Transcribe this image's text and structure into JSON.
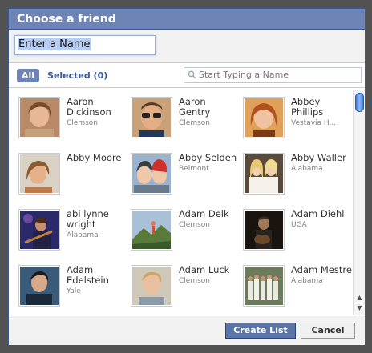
{
  "dialog": {
    "title": "Choose a friend"
  },
  "name_input": {
    "value": "Enter a Name"
  },
  "filter": {
    "all_label": "All",
    "selected_label": "Selected (0)",
    "search_placeholder": "Start Typing a Name"
  },
  "friends": [
    {
      "name": "Aaron Dickinson",
      "network": "Clemson"
    },
    {
      "name": "Aaron Gentry",
      "network": "Clemson"
    },
    {
      "name": "Abbey Phillips",
      "network": "Vestavia H..."
    },
    {
      "name": "Abby Moore",
      "network": ""
    },
    {
      "name": "Abby Selden",
      "network": "Belmont"
    },
    {
      "name": "Abby Waller",
      "network": "Alabama"
    },
    {
      "name": "abi lynne wright",
      "network": "Alabama"
    },
    {
      "name": "Adam Delk",
      "network": "Clemson"
    },
    {
      "name": "Adam Diehl",
      "network": "UGA"
    },
    {
      "name": "Adam Edelstein",
      "network": "Yale"
    },
    {
      "name": "Adam Luck",
      "network": "Clemson"
    },
    {
      "name": "Adam Mestre",
      "network": "Alabama"
    }
  ],
  "footer": {
    "create_label": "Create List",
    "cancel_label": "Cancel"
  },
  "colors": {
    "title_bar": "#6d84b4",
    "border": "#3b5998",
    "create_button": "#5b74a8",
    "tab_active": "#6d84b4"
  },
  "icons": [
    "search-icon",
    "scroll-up-icon",
    "scroll-down-icon"
  ]
}
